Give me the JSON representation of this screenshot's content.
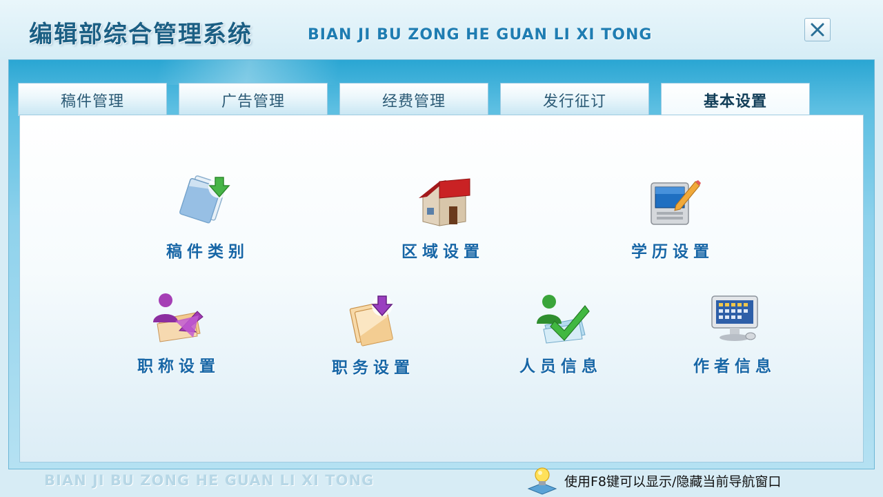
{
  "header": {
    "title_cn": "编辑部综合管理系统",
    "title_en": "BIAN JI BU ZONG HE GUAN LI XI TONG",
    "close_icon": "close-icon"
  },
  "tabs": [
    {
      "label": "稿件管理",
      "active": false
    },
    {
      "label": "广告管理",
      "active": false
    },
    {
      "label": "经费管理",
      "active": false
    },
    {
      "label": "发行征订",
      "active": false
    },
    {
      "label": "基本设置",
      "active": true
    }
  ],
  "items": [
    {
      "label": "稿件类别",
      "icon": "document-download-icon"
    },
    {
      "label": "区域设置",
      "icon": "house-icon"
    },
    {
      "label": "学历设置",
      "icon": "computer-pencil-icon"
    },
    {
      "label": "职称设置",
      "icon": "user-arrow-icon"
    },
    {
      "label": "职务设置",
      "icon": "document-arrow-icon"
    },
    {
      "label": "人员信息",
      "icon": "user-check-icon"
    },
    {
      "label": "作者信息",
      "icon": "monitor-icon"
    }
  ],
  "footer": {
    "title_en": "BIAN JI BU ZONG HE GUAN LI XI TONG",
    "hint": "使用F8键可以显示/隐藏当前导航窗口",
    "hint_icon": "lightbulb-icon"
  },
  "colors": {
    "title": "#1b5f84",
    "item_label": "#1766a6",
    "frame_blue": "#2aa6d3"
  }
}
